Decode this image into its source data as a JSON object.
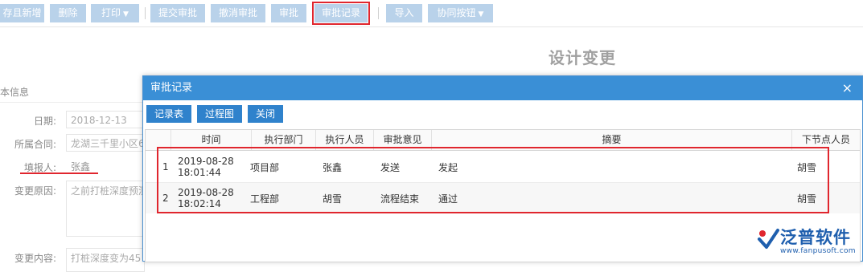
{
  "toolbar": {
    "buttons": [
      {
        "label": "存且新增"
      },
      {
        "label": "删除"
      },
      {
        "label": "打印",
        "caret": "▼"
      },
      {
        "label": "提交审批"
      },
      {
        "label": "撤消审批"
      },
      {
        "label": "审批"
      },
      {
        "label": "审批记录"
      },
      {
        "label": "导入"
      },
      {
        "label": "协同按钮",
        "caret": "▼"
      }
    ]
  },
  "form": {
    "title": "设计变更",
    "section": "本信息",
    "fields": [
      {
        "label": "日期:",
        "value": "2018-12-13"
      },
      {
        "label": "所属合同:",
        "value": "龙湖三千里小区6"
      },
      {
        "label": "填报人:",
        "value": "张鑫"
      },
      {
        "label": "变更原因:",
        "value": "之前打桩深度预测"
      },
      {
        "label": "变更内容:",
        "value": "打桩深度变为45"
      }
    ]
  },
  "dialog": {
    "title": "审批记录",
    "close": "×",
    "buttons": [
      "记录表",
      "过程图",
      "关闭"
    ],
    "columns": [
      "时间",
      "执行部门",
      "执行人员",
      "审批意见",
      "摘要",
      "下节点人员"
    ],
    "rows": [
      {
        "no": "1",
        "date": "2019-08-28",
        "time": "18:01:44",
        "dept": "项目部",
        "person": "张鑫",
        "opinion": "发送",
        "summary": "发起",
        "next": "胡雪"
      },
      {
        "no": "2",
        "date": "2019-08-28",
        "time": "18:02:14",
        "dept": "工程部",
        "person": "胡雪",
        "opinion": "流程结束",
        "summary": "通过",
        "next": "胡雪"
      }
    ]
  },
  "logo": {
    "name": "泛普软件",
    "url": "www.fanpusoft.com"
  },
  "colors": {
    "toolbar_button": "#b9d2ea",
    "dialog_header": "#3a8fd6",
    "dialog_button": "#2f82cc",
    "highlight_red": "#e0262e",
    "logo_blue": "#1f5fae"
  }
}
